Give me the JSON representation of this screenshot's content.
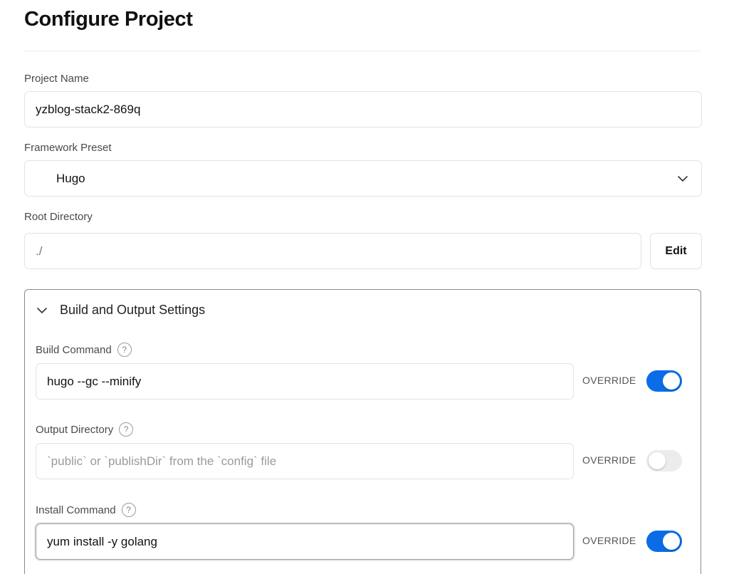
{
  "page": {
    "title": "Configure Project"
  },
  "project_name": {
    "label": "Project Name",
    "value": "yzblog-stack2-869q"
  },
  "framework_preset": {
    "label": "Framework Preset",
    "selected": "Hugo",
    "icon": "chevron-down-icon"
  },
  "root_directory": {
    "label": "Root Directory",
    "value": "./",
    "edit_label": "Edit"
  },
  "build_settings": {
    "section_title": "Build and Output Settings",
    "expanded": true,
    "override_label": "OVERRIDE",
    "accent_color": "#0a6ce6",
    "build_command": {
      "label": "Build Command",
      "value": "hugo --gc --minify",
      "placeholder": "",
      "override": true
    },
    "output_directory": {
      "label": "Output Directory",
      "value": "",
      "placeholder": "`public` or `publishDir` from the `config` file",
      "override": false
    },
    "install_command": {
      "label": "Install Command",
      "value": "yum install -y golang",
      "placeholder": "",
      "override": true
    }
  }
}
